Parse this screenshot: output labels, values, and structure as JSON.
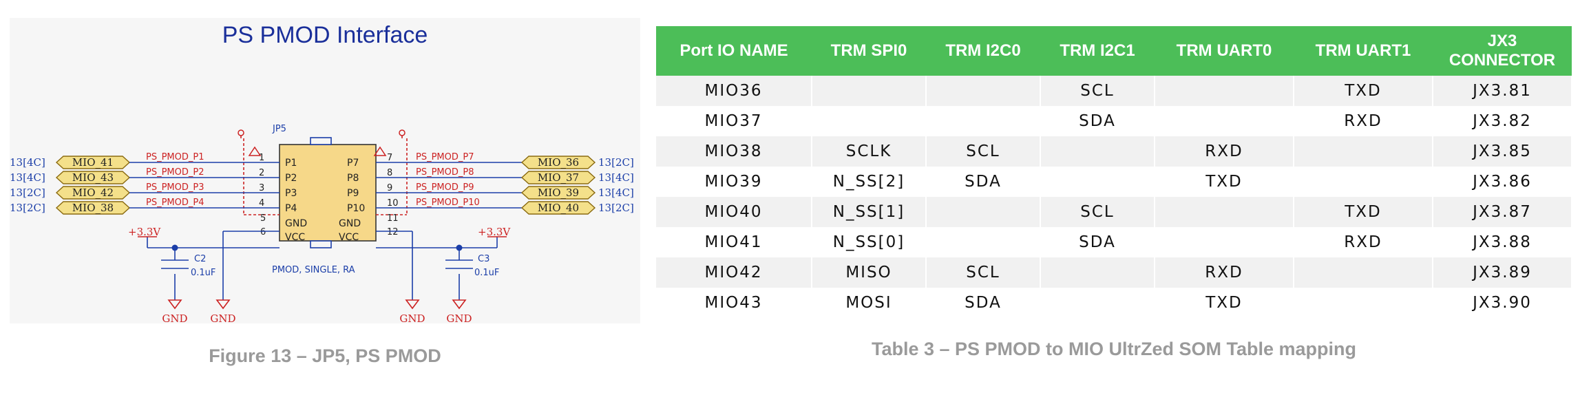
{
  "schematic": {
    "title": "PS PMOD Interface",
    "designator": "JP5",
    "part_label": "PMOD, SINGLE, RA",
    "left_nets": [
      {
        "bank": "13[4C]",
        "mio": "MIO_41",
        "net": "PS_PMOD_P1",
        "num": "1",
        "pin": "P1"
      },
      {
        "bank": "13[4C]",
        "mio": "MIO_43",
        "net": "PS_PMOD_P2",
        "num": "2",
        "pin": "P2"
      },
      {
        "bank": "13[2C]",
        "mio": "MIO_42",
        "net": "PS_PMOD_P3",
        "num": "3",
        "pin": "P3"
      },
      {
        "bank": "13[2C]",
        "mio": "MIO_38",
        "net": "PS_PMOD_P4",
        "num": "4",
        "pin": "P4"
      }
    ],
    "right_nets": [
      {
        "bank": "13[2C]",
        "mio": "MIO_36",
        "net": "PS_PMOD_P7",
        "num": "7",
        "pin": "P7"
      },
      {
        "bank": "13[4C]",
        "mio": "MIO_37",
        "net": "PS_PMOD_P8",
        "num": "8",
        "pin": "P8"
      },
      {
        "bank": "13[4C]",
        "mio": "MIO_39",
        "net": "PS_PMOD_P9",
        "num": "9",
        "pin": "P9"
      },
      {
        "bank": "13[2C]",
        "mio": "MIO_40",
        "net": "PS_PMOD_P10",
        "num": "10",
        "pin": "P10"
      }
    ],
    "left_power": [
      {
        "num": "5",
        "pin": "GND"
      },
      {
        "num": "6",
        "pin": "VCC"
      }
    ],
    "right_power": [
      {
        "num": "11",
        "pin": "GND"
      },
      {
        "num": "12",
        "pin": "VCC"
      }
    ],
    "supply": "+3.3V",
    "ground": "GND",
    "capacitors": [
      {
        "ref": "C2",
        "value": "0.1uF"
      },
      {
        "ref": "C3",
        "value": "0.1uF"
      }
    ]
  },
  "figure_caption": "Figure 13 – JP5, PS PMOD",
  "table": {
    "headers": [
      "Port IO NAME",
      "TRM SPI0",
      "TRM I2C0",
      "TRM I2C1",
      "TRM UART0",
      "TRM UART1",
      "JX3 CONNECTOR"
    ],
    "rows": [
      [
        "MIO36",
        "",
        "",
        "SCL",
        "",
        "TXD",
        "JX3.81"
      ],
      [
        "MIO37",
        "",
        "",
        "SDA",
        "",
        "RXD",
        "JX3.82"
      ],
      [
        "MIO38",
        "SCLK",
        "SCL",
        "",
        "RXD",
        "",
        "JX3.85"
      ],
      [
        "MIO39",
        "N_SS[2]",
        "SDA",
        "",
        "TXD",
        "",
        "JX3.86"
      ],
      [
        "MIO40",
        "N_SS[1]",
        "",
        "SCL",
        "",
        "TXD",
        "JX3.87"
      ],
      [
        "MIO41",
        "N_SS[0]",
        "",
        "SDA",
        "",
        "RXD",
        "JX3.88"
      ],
      [
        "MIO42",
        "MISO",
        "SCL",
        "",
        "RXD",
        "",
        "JX3.89"
      ],
      [
        "MIO43",
        "MOSI",
        "SDA",
        "",
        "TXD",
        "",
        "JX3.90"
      ]
    ]
  },
  "table_caption": "Table 3 – PS PMOD to MIO UltrZed SOM Table mapping",
  "colors": {
    "header_green": "#4cbe58",
    "net_blue": "#3355cc",
    "label_yellow": "#f4e08a",
    "label_border": "#8a6a10",
    "dashed_red": "#cc2222"
  }
}
